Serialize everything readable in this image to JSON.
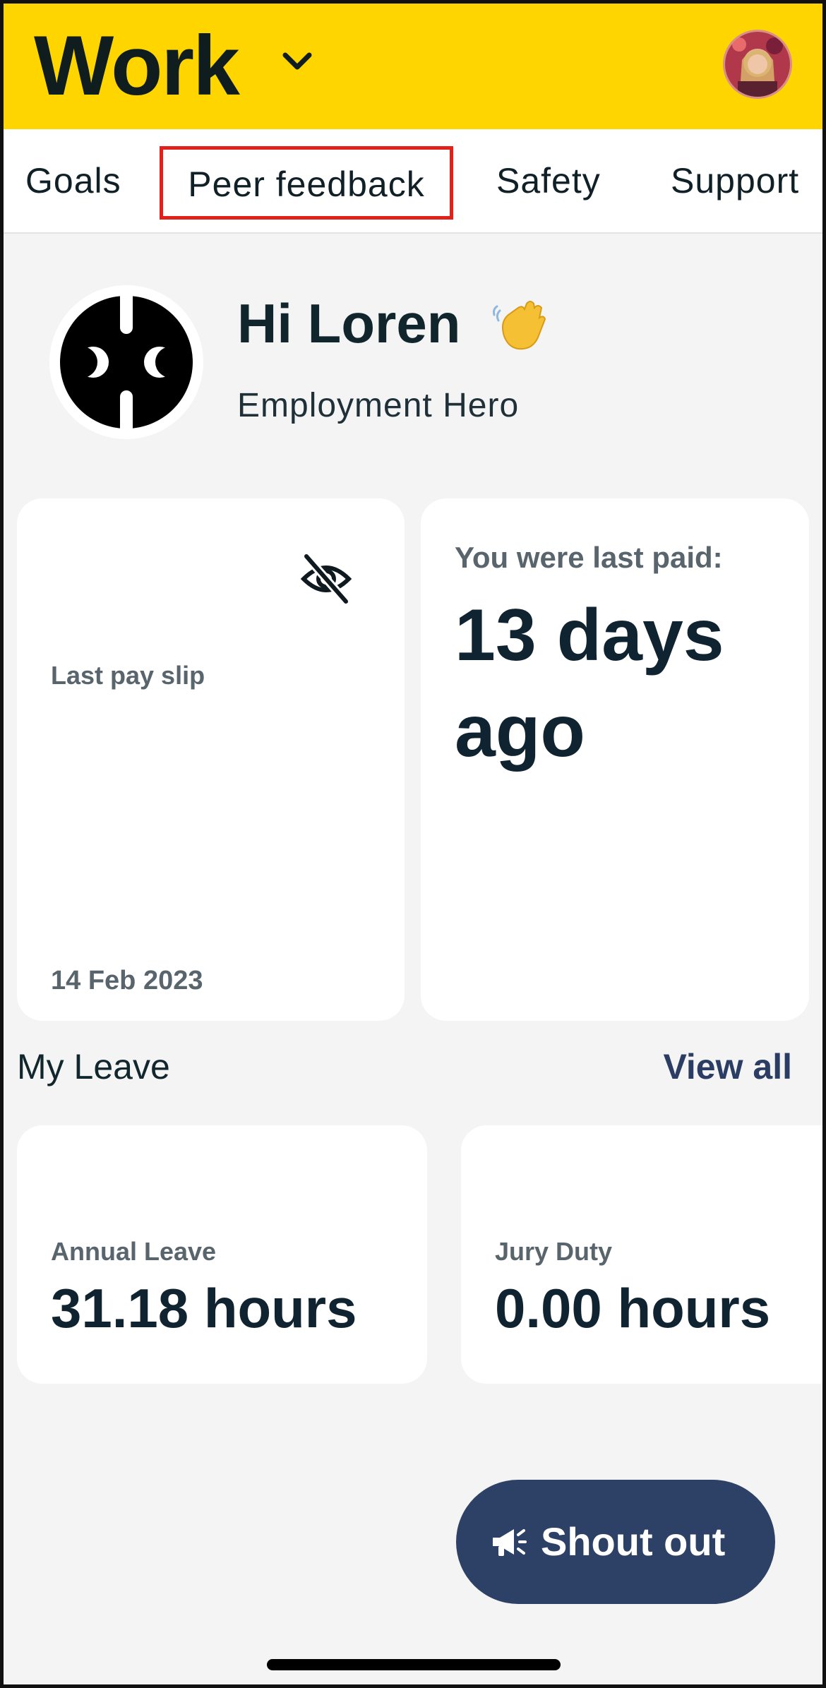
{
  "header": {
    "title": "Work",
    "dropdown_icon": "chevron-down-icon",
    "avatar_icon": "user-avatar",
    "background": "#ffd500"
  },
  "tabs": [
    {
      "label": "Goals"
    },
    {
      "label": "Peer feedback",
      "highlighted": true
    },
    {
      "label": "Safety"
    },
    {
      "label": "Support"
    }
  ],
  "profile": {
    "greeting": "Hi Loren",
    "emoji_icon": "waving-hand-icon",
    "company": "Employment Hero"
  },
  "payslip": {
    "label": "Last pay slip",
    "date": "14 Feb 2023",
    "icon": "eye-off-icon"
  },
  "last_paid": {
    "label": "You were last paid:",
    "value": "13 days ago"
  },
  "leave": {
    "title": "My Leave",
    "view_all": "View all",
    "items": [
      {
        "label": "Annual Leave",
        "value": "31.18 hours"
      },
      {
        "label": "Jury Duty",
        "value": "0.00 hours"
      }
    ]
  },
  "shout_out": {
    "label": "Shout out",
    "icon": "megaphone-icon",
    "color": "#2d4066"
  },
  "colors": {
    "accent_yellow": "#ffd500",
    "highlight_red": "#e0221a",
    "navy": "#2d4066"
  }
}
